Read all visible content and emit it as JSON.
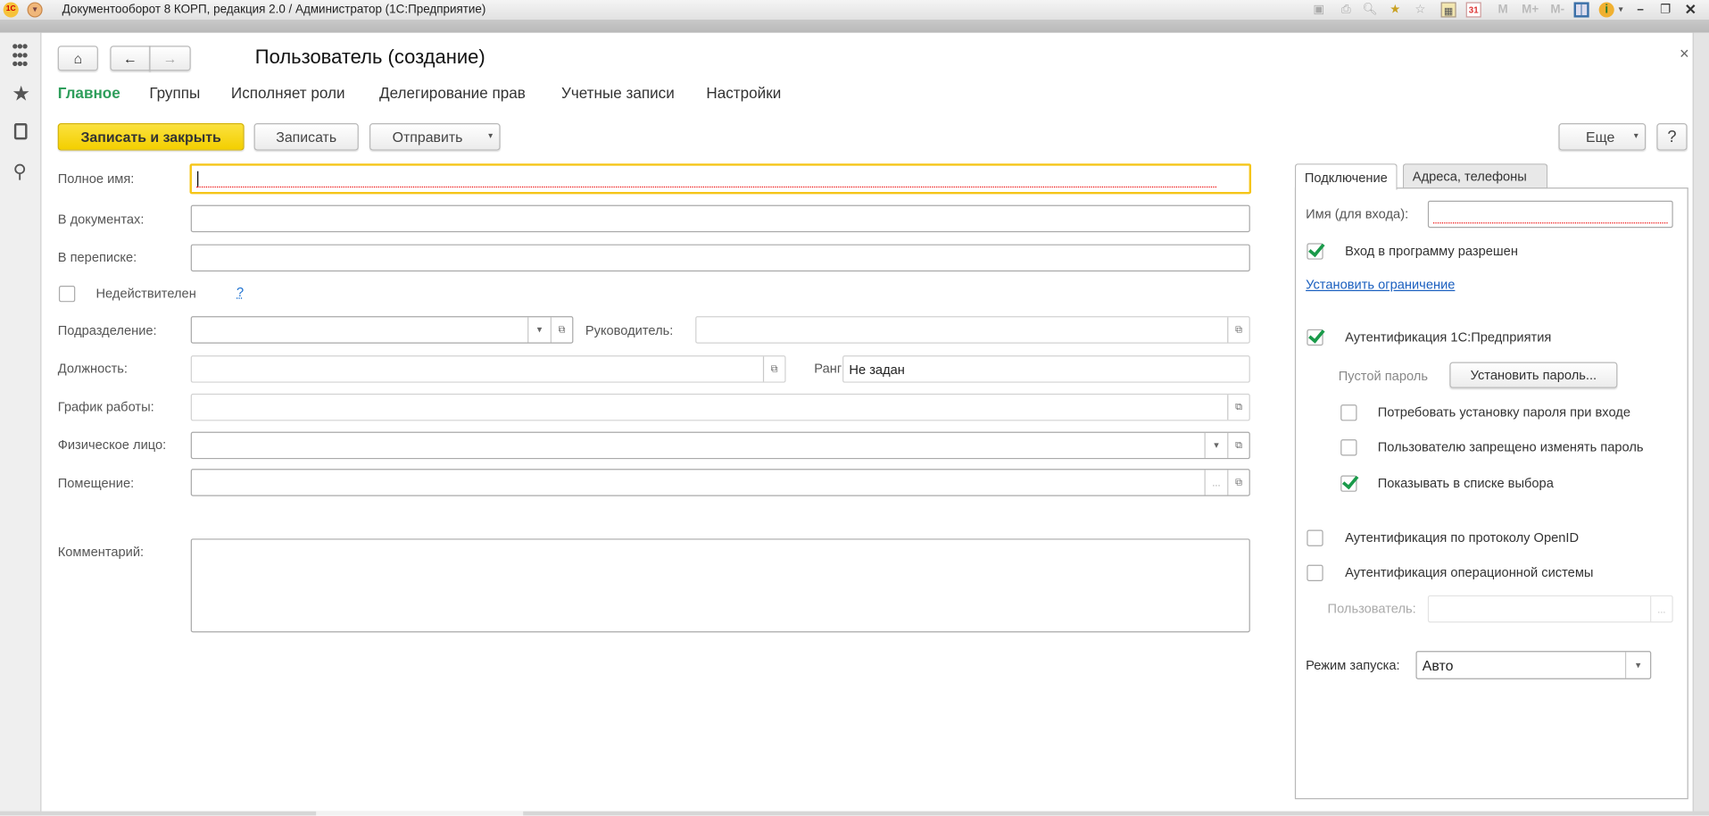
{
  "window": {
    "title": "Документооборот 8 КОРП, редакция 2.0 / Администратор  (1С:Предприятие)",
    "toolbar": {
      "m": "M",
      "mplus": "M+",
      "mminus": "M-",
      "calendar_day": "31"
    }
  },
  "form": {
    "title": "Пользователь (создание)",
    "close": "×"
  },
  "nav_tabs": [
    "Главное",
    "Группы",
    "Исполняет роли",
    "Делегирование прав",
    "Учетные записи",
    "Настройки"
  ],
  "command_bar": {
    "save_close": "Записать и закрыть",
    "save": "Записать",
    "send": "Отправить",
    "more": "Еще",
    "help": "?"
  },
  "fields": {
    "full_name": {
      "label": "Полное имя:",
      "value": ""
    },
    "in_documents": {
      "label": "В документах:",
      "value": ""
    },
    "in_correspondence": {
      "label": "В переписке:",
      "value": ""
    },
    "invalid": {
      "label": "Недействителен",
      "checked": false,
      "help": "?"
    },
    "department": {
      "label": "Подразделение:",
      "value": ""
    },
    "manager": {
      "label": "Руководитель:",
      "value": ""
    },
    "position": {
      "label": "Должность:",
      "value": ""
    },
    "rank": {
      "label": "Ранг:",
      "value": "Не задан"
    },
    "schedule": {
      "label": "График работы:",
      "value": ""
    },
    "person": {
      "label": "Физическое лицо:",
      "value": ""
    },
    "room": {
      "label": "Помещение:",
      "value": ""
    },
    "comment": {
      "label": "Комментарий:",
      "value": ""
    }
  },
  "panel": {
    "tabs": [
      "Подключение",
      "Адреса, телефоны"
    ],
    "login_label": "Имя (для входа):",
    "login_value": "",
    "login_allowed": {
      "label": "Вход в программу разрешен",
      "checked": true
    },
    "set_restriction": "Установить ограничение",
    "auth_1c": {
      "label": "Аутентификация 1С:Предприятия",
      "checked": true
    },
    "empty_password": "Пустой пароль",
    "set_password": "Установить пароль...",
    "require_password": {
      "label": "Потребовать установку пароля при входе",
      "checked": false
    },
    "forbid_change": {
      "label": "Пользователю запрещено изменять пароль",
      "checked": false
    },
    "show_in_list": {
      "label": "Показывать в списке выбора",
      "checked": true
    },
    "openid": {
      "label": "Аутентификация по протоколу OpenID",
      "checked": false
    },
    "os_auth": {
      "label": "Аутентификация операционной системы",
      "checked": false
    },
    "os_user_label": "Пользователь:",
    "os_user_value": "",
    "ellipsis": "...",
    "launch_mode_label": "Режим запуска:",
    "launch_mode_value": "Авто"
  },
  "colors": {
    "accent_green": "#2e9e5b",
    "primary_yellow": "#f3cf00",
    "link": "#1a5fbf",
    "focus": "#f5c518"
  }
}
